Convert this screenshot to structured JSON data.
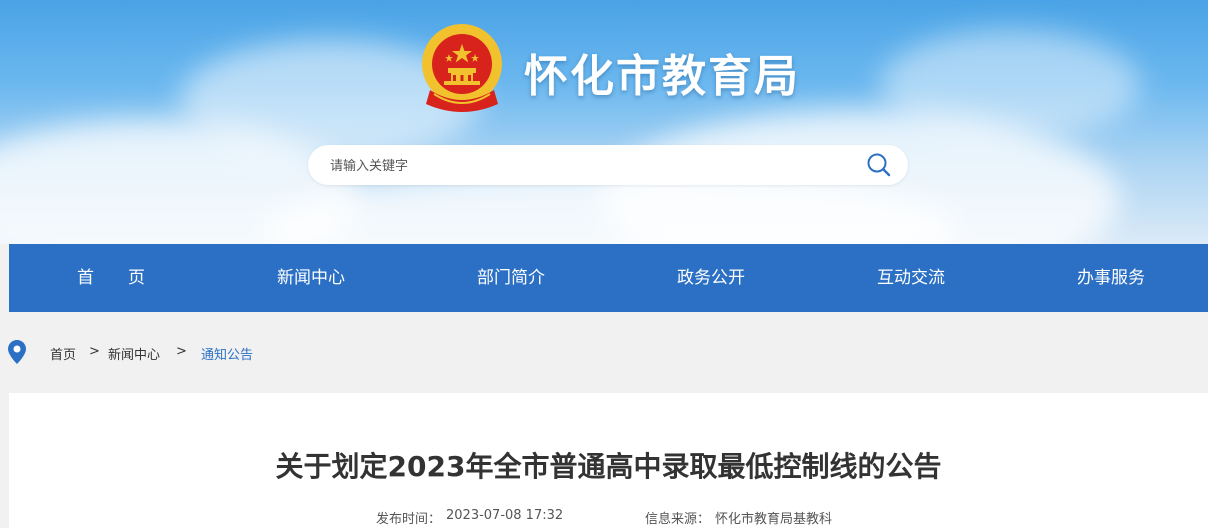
{
  "header": {
    "site_title": "怀化市教育局",
    "search_placeholder": "请输入关键字"
  },
  "nav": {
    "items": [
      "首　　页",
      "新闻中心",
      "部门简介",
      "政务公开",
      "互动交流",
      "办事服务"
    ]
  },
  "breadcrumb": {
    "home": "首页",
    "separator": ">",
    "section": "新闻中心",
    "current": "通知公告"
  },
  "article": {
    "title": "关于划定2023年全市普通高中录取最低控制线的公告",
    "publish_label": "发布时间：",
    "publish_time": "2023-07-08 17:32",
    "source_label": "信息来源：",
    "source": "怀化市教育局基教科"
  },
  "colors": {
    "nav_bg": "#2b70c4",
    "link_active": "#2b70c4",
    "emblem_red": "#d8231c",
    "emblem_gold": "#f2c12e"
  },
  "icons": [
    "national-emblem-icon",
    "search-icon",
    "location-pin-icon"
  ]
}
